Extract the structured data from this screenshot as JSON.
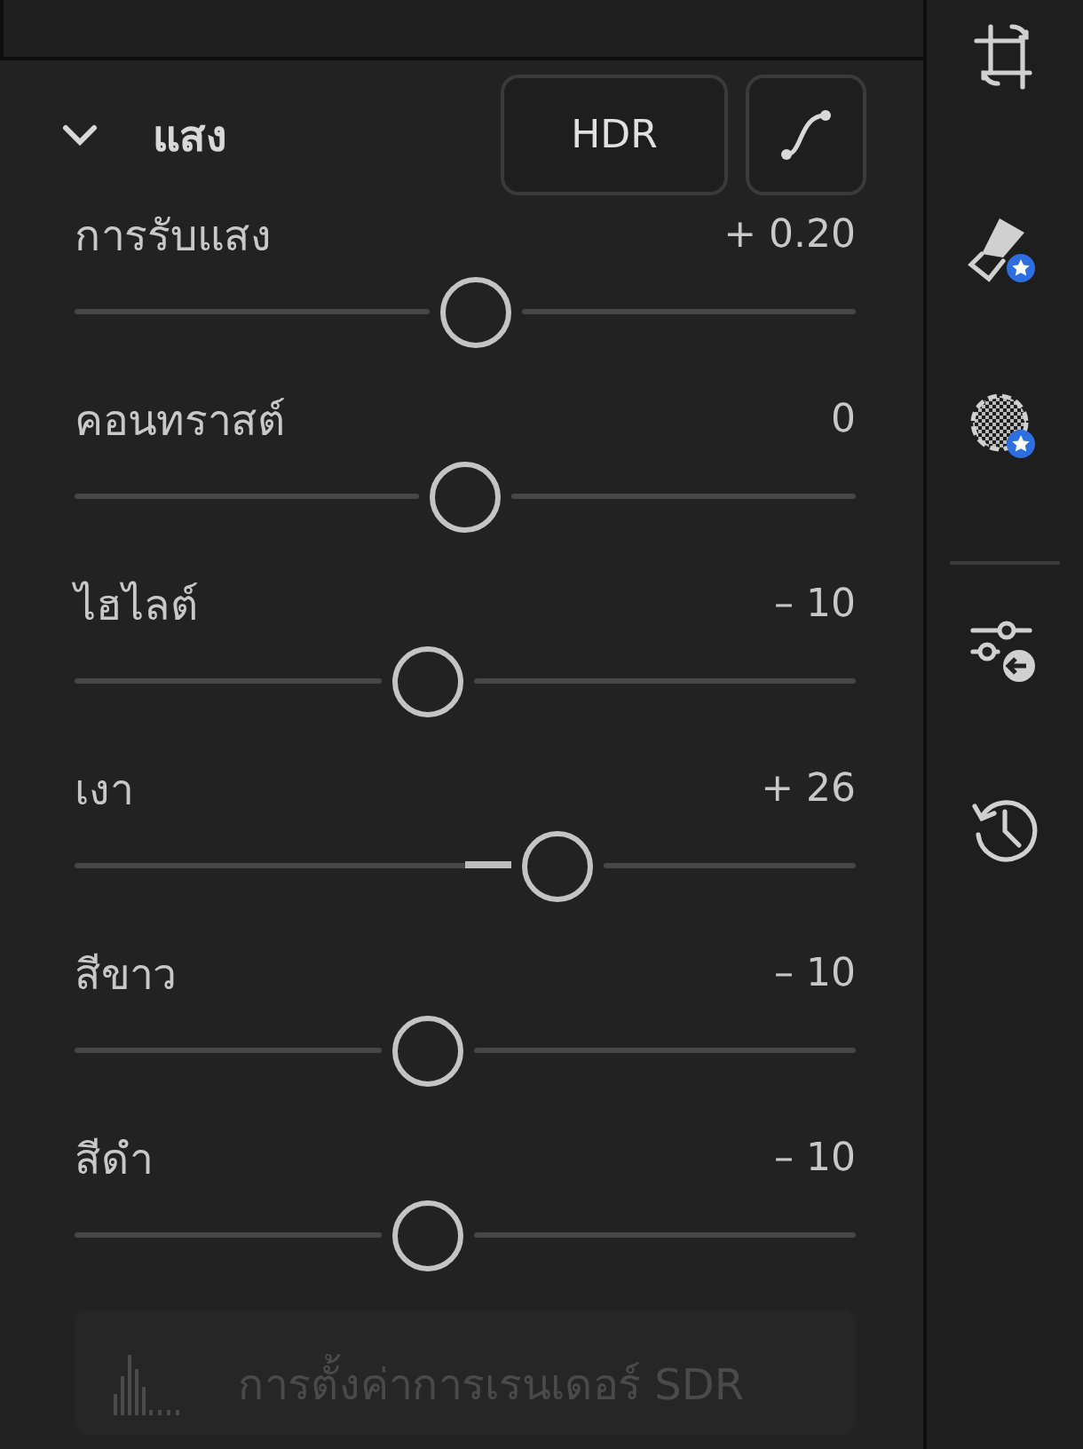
{
  "section": {
    "title": "แสง",
    "expanded": true,
    "buttons": [
      {
        "kind": "text",
        "label": "HDR"
      },
      {
        "kind": "curve"
      }
    ]
  },
  "sliders": [
    {
      "label": "การรับแสง",
      "reading": "+ 0.20",
      "level": 0.514
    },
    {
      "label": "คอนทราสต์",
      "reading": "0",
      "level": 0.5
    },
    {
      "label": "ไฮไลต์",
      "reading": "– 10",
      "level": 0.452
    },
    {
      "label": "เงา",
      "reading": "+ 26",
      "level": 0.618
    },
    {
      "label": "สีขาว",
      "reading": "– 10",
      "level": 0.452
    },
    {
      "label": "สีดำ",
      "reading": "– 10",
      "level": 0.452
    }
  ],
  "sdr_button": {
    "label": "การตั้งค่าการเรนเดอร์ SDR",
    "disabled": true
  },
  "toolbar": [
    {
      "kind": "crop"
    },
    {
      "kind": "brush"
    },
    {
      "kind": "mask"
    },
    {
      "kind": "divider"
    },
    {
      "kind": "presets"
    },
    {
      "kind": "history"
    }
  ]
}
